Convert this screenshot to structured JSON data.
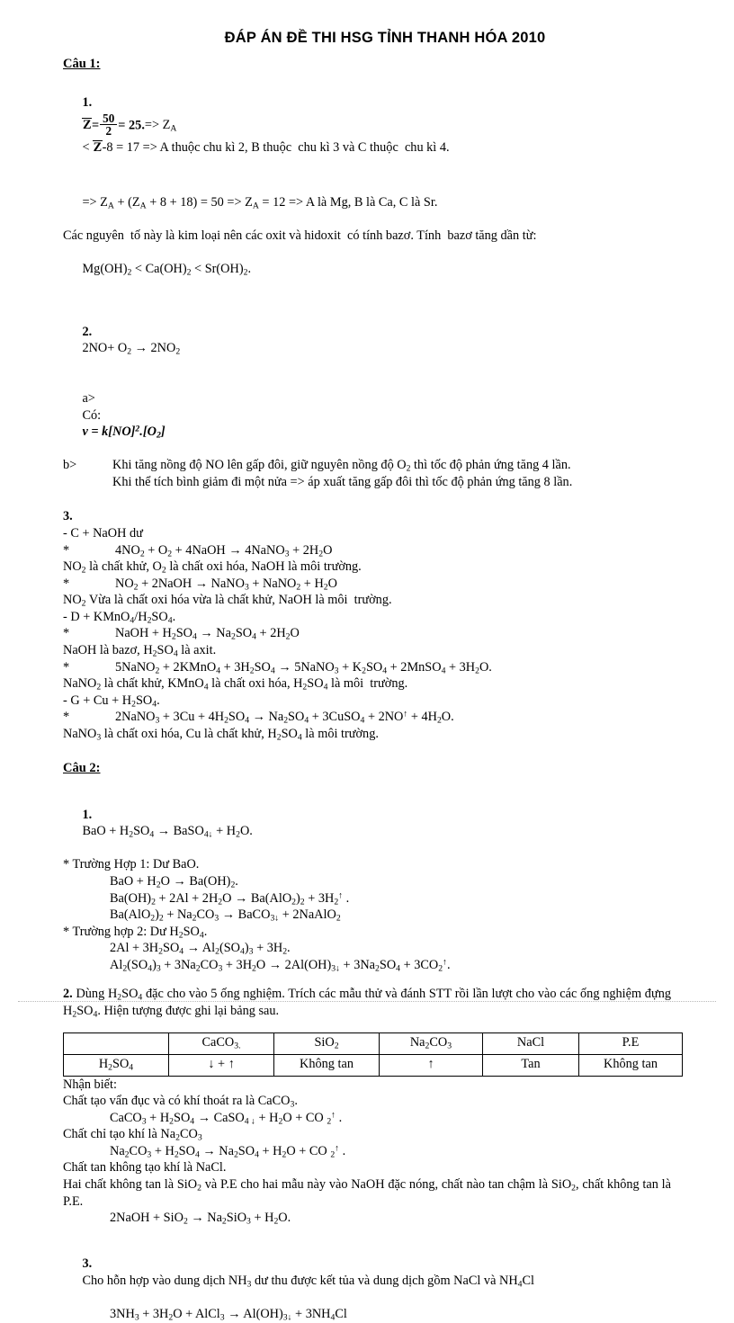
{
  "document": {
    "title": "ĐÁP ÁN ĐỀ THI HSG TỈNH THANH HÓA 2010"
  },
  "cau1": {
    "heading": "Câu 1:",
    "item1": {
      "prefix": "1.",
      "zbar": "Z",
      "eq_equals": "=",
      "frac_num": "50",
      "frac_den": "2",
      "frac_result": "= 25.",
      "rest": "=> Z",
      "sub_a": "A",
      "lt": "< ",
      "zbar2": "Z",
      "tail": "-8 = 17 => A thuộc chu kì 2, B thuộc  chu kì 3 và C thuộc  chu kì 4.",
      "line2": "=> ZA + (ZA + 8 + 18) = 50 => ZA = 12 => A là Mg, B là Ca, C là Sr.",
      "line3": "Các nguyên  tố này là kim loại nên các oxit và hidoxit  có tính bazơ. Tính  bazơ tăng dần từ:",
      "line4": "Mg(OH)2 < Ca(OH)2 < Sr(OH)2."
    },
    "item2": {
      "prefix": "2.",
      "equation": "2NO+ O2 → 2NO2",
      "a_tag": "a>",
      "a_label": "Có:",
      "a_formula": "v = k[NO]2.[O2]",
      "b_tag": "b>",
      "b_line1": "Khi tăng nồng độ NO lên gấp đôi, giữ nguyên  nồng độ O2 thì tốc độ phản ứng tăng 4 lần.",
      "b_line2": "Khi thể tích bình giảm  đi một nửa => áp xuất tăng gấp đôi thì tốc độ phản ứng tăng 8 lần."
    },
    "item3": {
      "prefix": "3.",
      "lines": [
        "- C + NaOH dư",
        "4NO2 + O2 + 4NaOH →  4NaNO3 + 2H2O",
        "NO2 là chất khử, O2 là chất oxi hóa, NaOH là môi trường.",
        "NO2 + 2NaOH → NaNO3 + NaNO2 + H2O",
        "NO2 Vừa là chất oxi hóa vừa là chất khử, NaOH là môi  trường.",
        "- D + KMnO4/H2SO4.",
        "NaOH + H2SO4 → Na2SO4 + 2H2O",
        "NaOH là bazơ, H2SO4 là axit.",
        "5NaNO2 + 2KMnO4 +  3H2SO4  →  5NaNO3 + K2SO4 + 2MnSO4 + 3H2O.",
        "NaNO2 là chất khử, KMnO4 là chất oxi hóa, H2SO4 là môi  trường.",
        "- G + Cu + H2SO4.",
        "2NaNO3 + 3Cu + 4H2SO4  → Na2SO4 + 3CuSO4 + 2NO↑ + 4H2O.",
        "NaNO3 là chất oxi hóa, Cu là chất khử, H2SO4 là môi trường."
      ],
      "star": "*"
    }
  },
  "cau2": {
    "heading": "Câu 2:",
    "item1": {
      "prefix": "1.",
      "main": "BaO + H2SO4 → BaSO4↓ + H2O.",
      "case1_label": "* Trường Hợp 1: Dư BaO.",
      "case1_eqs": [
        "BaO + H2O → Ba(OH)2.",
        "Ba(OH)2 + 2Al + 2H2O → Ba(AlO2)2 + 3H2↑ .",
        "Ba(AlO2)2 + Na2CO3 → BaCO3↓ + 2NaAlO2"
      ],
      "case2_label": "* Trường hợp 2: Dư H2SO4.",
      "case2_eqs": [
        "2Al + 3H2SO4 → Al2(SO4)3 + 3H2.",
        "Al2(SO4)3 + 3Na2CO3 + 3H2O → 2Al(OH)3↓ + 3Na2SO4 + 3CO2↑."
      ]
    },
    "item2": {
      "prefix": "2.",
      "intro": "Dùng  H2SO4  đặc cho vào 5 ống nghiệm.   Trích  các mẫu thử và đánh STT rồi lần lượt cho vào các ống nghiệm  đựng H2SO4. Hiện tượng được ghi lại bảng sau.",
      "table": {
        "header_row": [
          "",
          "CaCO3.",
          "SiO2",
          "Na2CO3",
          "NaCl",
          "P.E"
        ],
        "data_row": [
          "H2SO4",
          "↓ + ↑",
          "Không tan",
          "↑",
          "Tan",
          "Không tan"
        ]
      },
      "recognize_label": "Nhận biết:",
      "lines": [
        "Chất tạo vẩn đục và có khí thoát ra là CaCO3.",
        "CaCO3 + H2SO4 → CaSO4 ↓ + H2O + CO 2↑ .",
        "Chất chỉ tạo khí là Na2CO3",
        "Na2CO3 + H2SO4 → Na2SO4 + H2O + CO 2↑ .",
        "Chất tan không tạo khí là NaCl.",
        "Hai chất không tan là SiO2 và P.E cho hai mẫu này vào NaOH đặc nóng, chất nào tan chậm là SiO2, chất không tan là P.E.",
        "2NaOH + SiO2 → Na2SiO3 + H2O."
      ]
    },
    "item3": {
      "prefix": "3.",
      "intro": "Cho hỗn hợp vào dung dịch NH3 dư thu được kết tủa và dung dịch gồm NaCl và NH4Cl",
      "equation": "3NH3 + 3H2O + AlCl3 → Al(OH)3↓ + 3NH4Cl"
    }
  }
}
